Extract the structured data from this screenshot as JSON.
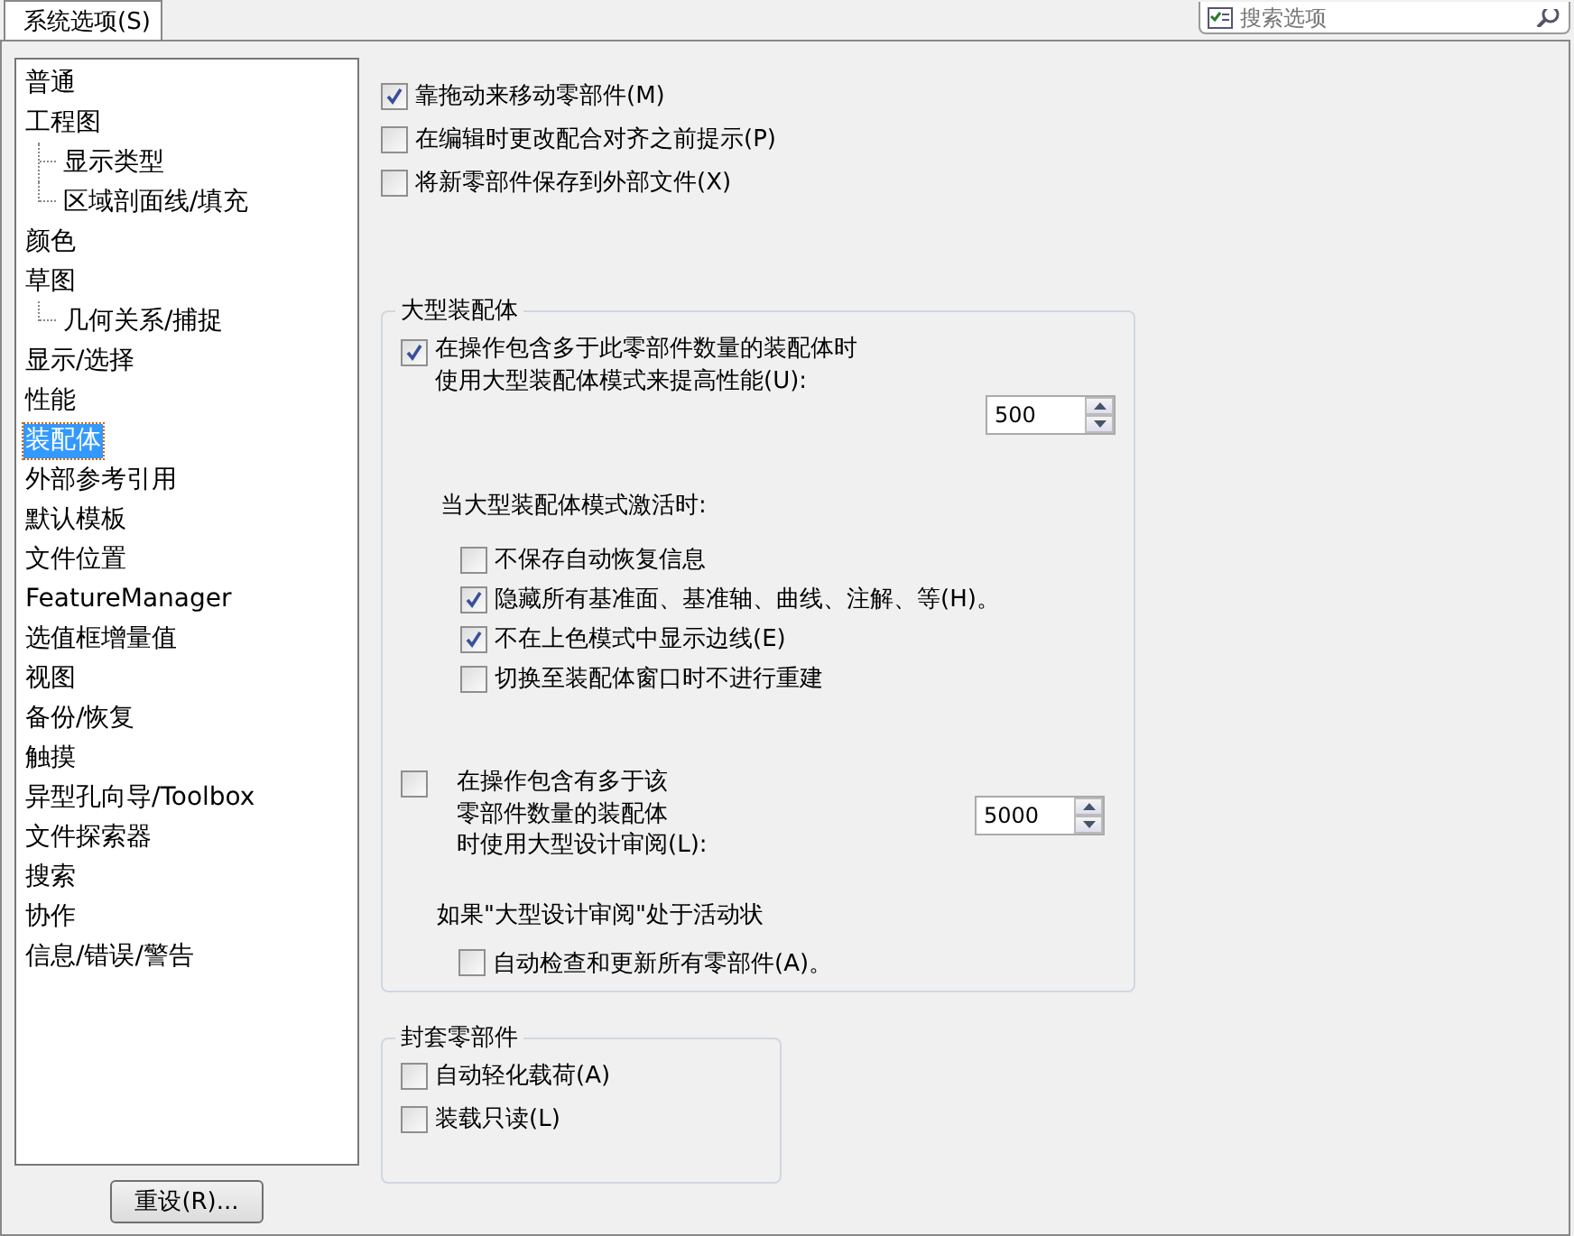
{
  "tabs": [
    {
      "label": "系统选项(S)",
      "selected": true
    }
  ],
  "search": {
    "placeholder": "搜索选项"
  },
  "sidebar": {
    "items": [
      {
        "label": "普通",
        "selected": false
      },
      {
        "label": "工程图",
        "selected": false,
        "children": [
          {
            "label": "显示类型",
            "selected": false
          },
          {
            "label": "区域剖面线/填充",
            "selected": false
          }
        ]
      },
      {
        "label": "颜色",
        "selected": false
      },
      {
        "label": "草图",
        "selected": false,
        "children": [
          {
            "label": "几何关系/捕捉",
            "selected": false
          }
        ]
      },
      {
        "label": "显示/选择",
        "selected": false
      },
      {
        "label": "性能",
        "selected": false
      },
      {
        "label": "装配体",
        "selected": true
      },
      {
        "label": "外部参考引用",
        "selected": false
      },
      {
        "label": "默认模板",
        "selected": false
      },
      {
        "label": "文件位置",
        "selected": false
      },
      {
        "label": "FeatureManager",
        "selected": false
      },
      {
        "label": "选值框增量值",
        "selected": false
      },
      {
        "label": "视图",
        "selected": false
      },
      {
        "label": "备份/恢复",
        "selected": false
      },
      {
        "label": "触摸",
        "selected": false
      },
      {
        "label": "异型孔向导/Toolbox",
        "selected": false
      },
      {
        "label": "文件探索器",
        "selected": false
      },
      {
        "label": "搜索",
        "selected": false
      },
      {
        "label": "协作",
        "selected": false
      },
      {
        "label": "信息/错误/警告",
        "selected": false
      }
    ]
  },
  "reset_button": {
    "label": "重设(R)..."
  },
  "options": [
    {
      "label": "靠拖动来移动零部件(M)",
      "checked": true
    },
    {
      "label": "在编辑时更改配合对齐之前提示(P)",
      "checked": false
    },
    {
      "label": "将新零部件保存到外部文件(X)",
      "checked": false
    }
  ],
  "large_assembly": {
    "title": "大型装配体",
    "threshold_option": {
      "lines": [
        "在操作包含多于此零部件数量的装配体时",
        "使用大型装配体模式来提高性能(U):"
      ],
      "checked": true,
      "value": "500"
    },
    "when_active_label": "当大型装配体模式激活时:",
    "when_active_options": [
      {
        "label": "不保存自动恢复信息",
        "checked": false
      },
      {
        "label": "隐藏所有基准面、基准轴、曲线、注解、等(H)。",
        "checked": true
      },
      {
        "label": "不在上色模式中显示边线(E)",
        "checked": true
      },
      {
        "label": "切换至装配体窗口时不进行重建",
        "checked": false
      }
    ],
    "review_option": {
      "lines": [
        "在操作包含有多于该",
        "零部件数量的装配体",
        "时使用大型设计审阅(L):"
      ],
      "checked": false,
      "value": "5000"
    },
    "review_active_label": "如果\"大型设计审阅\"处于活动状",
    "review_active_options": [
      {
        "label": "自动检查和更新所有零部件(A)。",
        "checked": false
      }
    ]
  },
  "envelope": {
    "title": "封套零部件",
    "options": [
      {
        "label": "自动轻化载荷(A)",
        "checked": false
      },
      {
        "label": "装载只读(L)",
        "checked": false
      }
    ]
  }
}
